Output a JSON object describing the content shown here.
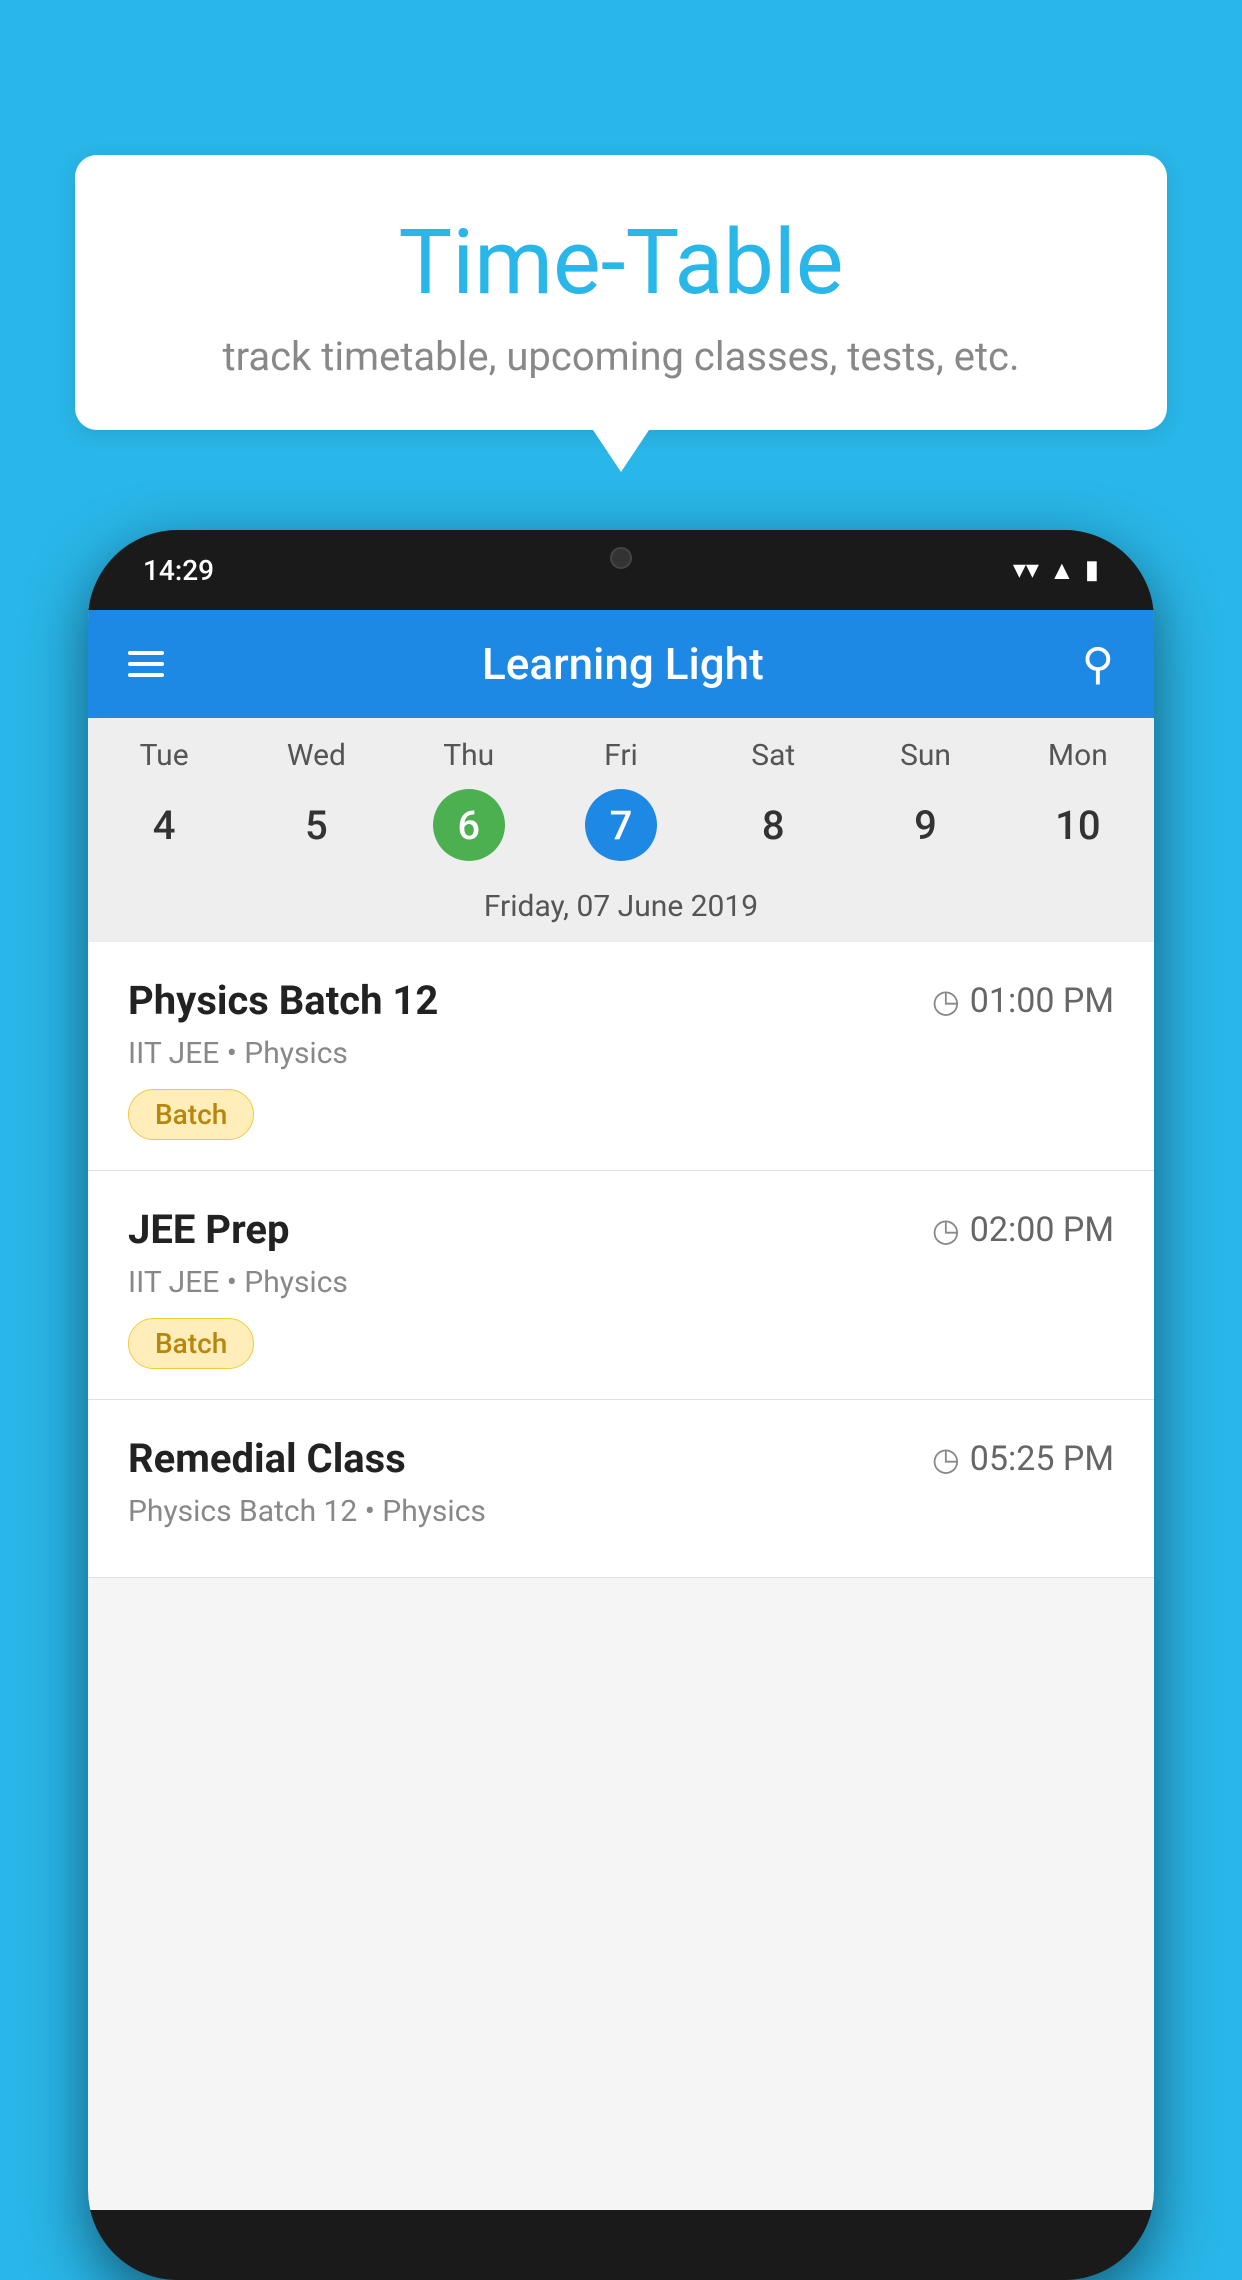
{
  "background_color": "#29b6e8",
  "bubble": {
    "title": "Time-Table",
    "subtitle": "track timetable, upcoming classes, tests, etc."
  },
  "phone": {
    "status_bar": {
      "time": "14:29"
    },
    "app_header": {
      "title": "Learning Light"
    },
    "calendar": {
      "days": [
        "Tue",
        "Wed",
        "Thu",
        "Fri",
        "Sat",
        "Sun",
        "Mon"
      ],
      "dates": [
        "4",
        "5",
        "6",
        "7",
        "8",
        "9",
        "10"
      ],
      "today_index": 2,
      "selected_index": 3,
      "selected_label": "Friday, 07 June 2019"
    },
    "classes": [
      {
        "name": "Physics Batch 12",
        "time": "01:00 PM",
        "meta": "IIT JEE • Physics",
        "tag": "Batch"
      },
      {
        "name": "JEE Prep",
        "time": "02:00 PM",
        "meta": "IIT JEE • Physics",
        "tag": "Batch"
      },
      {
        "name": "Remedial Class",
        "time": "05:25 PM",
        "meta": "Physics Batch 12 • Physics",
        "tag": ""
      }
    ]
  }
}
